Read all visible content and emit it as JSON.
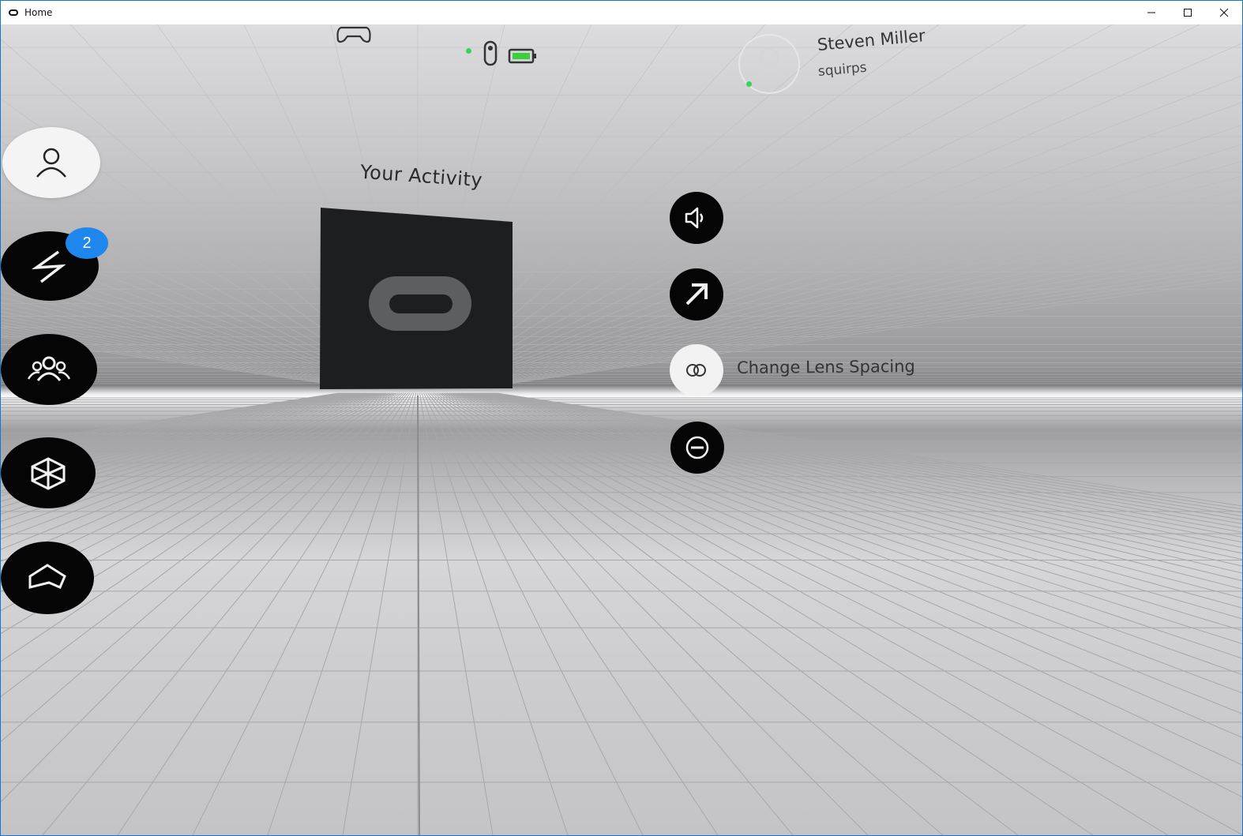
{
  "window": {
    "title": "Home"
  },
  "user": {
    "name": "Steven Miller",
    "handle": "squirps",
    "status": "online"
  },
  "status_bar": {
    "icons": [
      "gamepad-icon",
      "remote-icon",
      "battery-icon"
    ],
    "remote_status": "connected"
  },
  "nav": {
    "items": [
      {
        "name": "profile",
        "icon": "person-icon",
        "active": true
      },
      {
        "name": "notifications",
        "icon": "lightning-icon",
        "badge": "2"
      },
      {
        "name": "friends",
        "icon": "people-icon"
      },
      {
        "name": "library",
        "icon": "cube-icon"
      },
      {
        "name": "home",
        "icon": "home-icon"
      }
    ]
  },
  "activity": {
    "title": "Your Activity"
  },
  "actions": {
    "items": [
      {
        "name": "volume",
        "icon": "speaker-icon"
      },
      {
        "name": "open",
        "icon": "arrow-up-right-icon"
      },
      {
        "name": "lens-spacing",
        "icon": "lens-icon",
        "label": "Change Lens Spacing",
        "highlighted": true
      },
      {
        "name": "sleep",
        "icon": "minus-circle-icon"
      }
    ]
  },
  "colors": {
    "accent": "#1f86ee",
    "online": "#38d35a",
    "battery": "#3ccf3c"
  }
}
